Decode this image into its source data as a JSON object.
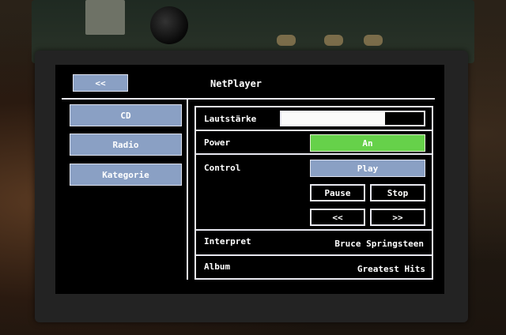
{
  "header": {
    "back_label": "<<",
    "title": "NetPlayer"
  },
  "sidebar": {
    "items": [
      {
        "label": "CD"
      },
      {
        "label": "Radio"
      },
      {
        "label": "Kategorie"
      }
    ]
  },
  "panel": {
    "volume": {
      "label": "Lautstärke",
      "level": 0.73
    },
    "power": {
      "label": "Power",
      "value": "An"
    },
    "control": {
      "label": "Control",
      "play": "Play",
      "pause": "Pause",
      "stop": "Stop",
      "prev": "<<",
      "next": ">>"
    },
    "interpret": {
      "label": "Interpret",
      "value": "Bruce Springsteen"
    },
    "album": {
      "label": "Album",
      "value": "Greatest Hits"
    }
  },
  "colors": {
    "button_blue": "#8aa0c4",
    "power_green": "#66d14a",
    "screen_bg": "#000000"
  }
}
